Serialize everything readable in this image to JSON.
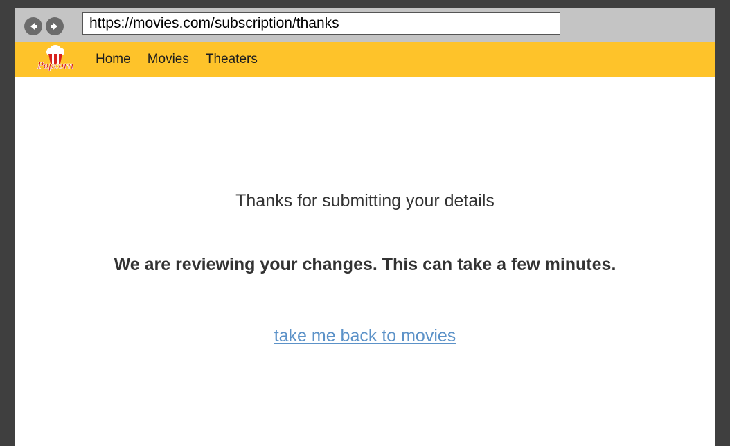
{
  "browser": {
    "url": "https://movies.com/subscription/thanks"
  },
  "navbar": {
    "logo_text": "Popcorn",
    "links": [
      "Home",
      "Movies",
      "Theaters"
    ]
  },
  "main": {
    "thanks_text": "Thanks for submitting your details",
    "review_text": "We are reviewing your changes. This can take a few minutes.",
    "back_link_text": "take me back to movies"
  },
  "colors": {
    "navbar": "#fec32a",
    "link": "#5c92c8",
    "browser_chrome": "#c4c4c4"
  }
}
